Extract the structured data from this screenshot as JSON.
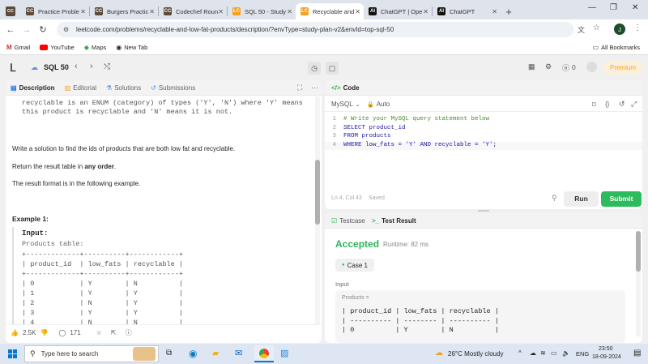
{
  "browser": {
    "tabs": [
      {
        "icon": "CC",
        "label": "Practice Proble",
        "color": "#5b4a3a"
      },
      {
        "icon": "CC",
        "label": "Burgers Practic",
        "color": "#5b4a3a"
      },
      {
        "icon": "CC",
        "label": "Codechef Roun",
        "color": "#5b4a3a"
      },
      {
        "icon": "LC",
        "label": "SQL 50 - Study",
        "color": "#f89f1b"
      },
      {
        "icon": "LC",
        "label": "Recyclable and",
        "color": "#f89f1b"
      },
      {
        "icon": "AI",
        "label": "ChatGPT | Ope",
        "color": "#111"
      },
      {
        "icon": "AI",
        "label": "ChatGPT",
        "color": "#111"
      }
    ],
    "url": "leetcode.com/problems/recyclable-and-low-fat-products/description/?envType=study-plan-v2&envId=top-sql-50",
    "bookmarks": [
      "Gmail",
      "YouTube",
      "Maps",
      "New Tab"
    ],
    "all_bookmarks": "All Bookmarks",
    "profile_initial": "J"
  },
  "header": {
    "study_plan": "SQL 50",
    "streak_count": "0",
    "premium": "Premium"
  },
  "left_panel": {
    "tabs": [
      "Description",
      "Editorial",
      "Solutions",
      "Submissions"
    ],
    "code_top_1": "recyclable is an ENUM (category) of types ('Y', 'N') where 'Y' means",
    "code_top_2": "this product is recyclable and 'N' means it is not.",
    "task": "Write a solution to find the ids of products that are both low fat and recyclable.",
    "return_pre": "Return the result table in ",
    "return_bold": "any order",
    "return_post": ".",
    "format": "The result format is in the following example.",
    "example_title": "Example 1:",
    "input_label": "Input:",
    "products_label": "Products table:",
    "table_border": "+-------------+----------+------------+",
    "table_header": "| product_id  | low_fats | recyclable |",
    "table_rows": [
      "| 0           | Y        | N          |",
      "| 1           | Y        | Y          |",
      "| 2           | N        | Y          |",
      "| 3           | Y        | Y          |",
      "| 4           | N        | N          |"
    ],
    "likes": "2.5K",
    "comments": "171"
  },
  "code_panel": {
    "title": "Code",
    "language": "MySQL",
    "auto": "Auto",
    "lines": [
      {
        "n": "1",
        "text": "# Write your MySQL query statement below"
      },
      {
        "n": "2",
        "text": "SELECT product_id"
      },
      {
        "n": "3",
        "text": "FROM products"
      },
      {
        "n": "4",
        "text": "WHERE low_fats = 'Y' AND recyclable = 'Y';"
      }
    ],
    "status": "Ln 4, Col 43",
    "saved": "Saved",
    "run": "Run",
    "submit": "Submit"
  },
  "result_panel": {
    "testcase_tab": "Testcase",
    "result_tab": "Test Result",
    "status": "Accepted",
    "runtime": "Runtime: 82 ms",
    "case": "Case 1",
    "input_label": "Input",
    "products_label": "Products =",
    "table_header": "| product_id | low_fats | recyclable |",
    "table_sep": "| ---------- | -------- | ---------- |",
    "table_row": "| 0          | Y        | N          |"
  },
  "taskbar": {
    "search_placeholder": "Type here to search",
    "weather": "26°C  Mostly cloudy",
    "lang": "ENG",
    "time": "23:50",
    "date": "18-09-2024"
  },
  "colors": {
    "accent_green": "#2cbb5d",
    "accepted_green": "#2db55d",
    "premium_orange": "#ffa116",
    "link_blue": "#1a73e8"
  }
}
